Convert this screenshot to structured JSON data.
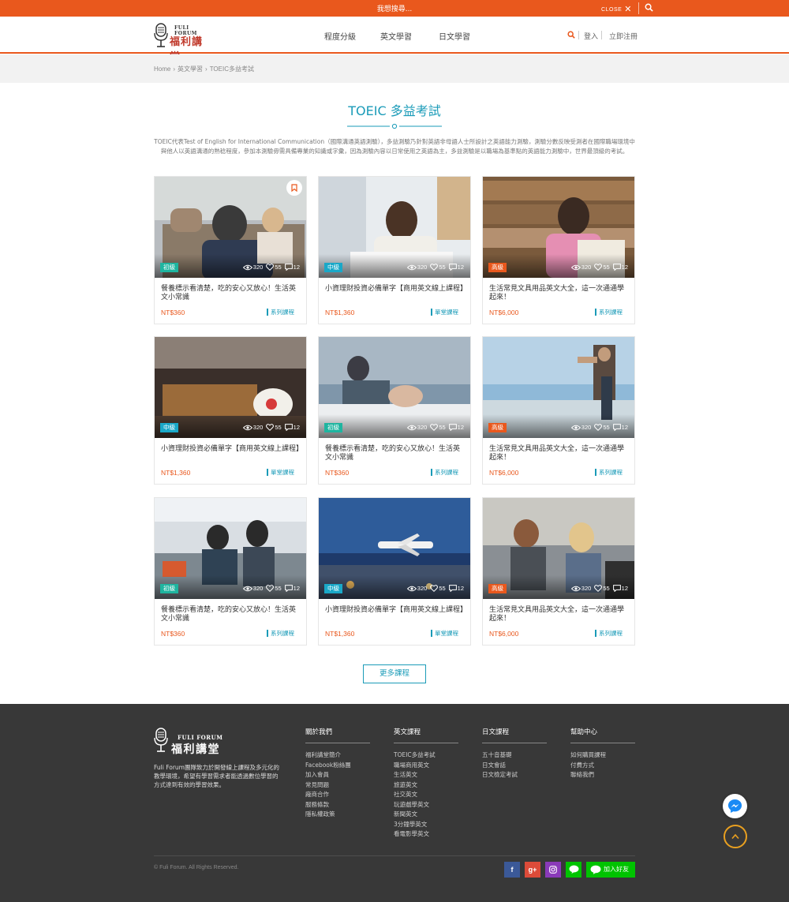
{
  "topbar": {
    "search_text": "我想搜尋...",
    "close_label": "CLOSE"
  },
  "header": {
    "logo_small": "FULI FORUM",
    "logo_big": "福利講堂",
    "nav": [
      "程度分級",
      "英文學習",
      "日文學習"
    ],
    "login": "登入",
    "register": "立即注冊"
  },
  "breadcrumb": [
    "Home",
    "英文學習",
    "TOEIC多益考試"
  ],
  "page": {
    "title": "TOEIC 多益考試",
    "intro": "TOEIC代表Test of English for International Communication（國際溝通英語測驗），多益測驗乃針對英語非母語人士所設計之英語能力測驗，測驗分數反映受測者在國際職場環境中與他人以英語溝通的熟稔程度，參加本測驗毋需具備專業的知識或字彙，因為測驗內容以日常使用之英語為主，多益測驗是以職場為基準點的英語能力測驗中，世界最頂級的考試。"
  },
  "colors": {
    "accent": "#e9581d",
    "teal": "#1a9bb8",
    "level_beginner": "#1fb5a0",
    "level_mid": "#1aa8c8",
    "level_high": "#e9581d"
  },
  "cards": [
    {
      "level": "初級",
      "level_class": "beginner",
      "views": "320",
      "likes": "55",
      "comments": "12",
      "title": "餐養標示看清楚，吃的安心又放心！生活英文小常識",
      "price": "NT$360",
      "tag": "系列課程",
      "bookmark": true
    },
    {
      "level": "中級",
      "level_class": "mid",
      "views": "320",
      "likes": "55",
      "comments": "12",
      "title": "小資理財投資必備單字【商用英文線上課程】",
      "price": "NT$1,360",
      "tag": "單堂課程",
      "bookmark": false
    },
    {
      "level": "高級",
      "level_class": "high",
      "views": "320",
      "likes": "55",
      "comments": "12",
      "title": "生活常見文具用品英文大全，這一次通通學起來！",
      "price": "NT$6,000",
      "tag": "系列課程",
      "bookmark": false
    },
    {
      "level": "中級",
      "level_class": "mid",
      "views": "320",
      "likes": "55",
      "comments": "12",
      "title": "小資理財投資必備單字【商用英文線上課程】",
      "price": "NT$1,360",
      "tag": "單堂課程",
      "bookmark": false
    },
    {
      "level": "初級",
      "level_class": "beginner",
      "views": "320",
      "likes": "55",
      "comments": "12",
      "title": "餐養標示看清楚，吃的安心又放心！生活英文小常識",
      "price": "NT$360",
      "tag": "系列課程",
      "bookmark": false
    },
    {
      "level": "高級",
      "level_class": "high",
      "views": "320",
      "likes": "55",
      "comments": "12",
      "title": "生活常見文具用品英文大全，這一次通通學起來！",
      "price": "NT$6,000",
      "tag": "系列課程",
      "bookmark": false
    },
    {
      "level": "初級",
      "level_class": "beginner",
      "views": "320",
      "likes": "55",
      "comments": "12",
      "title": "餐養標示看清楚，吃的安心又放心！生活英文小常識",
      "price": "NT$360",
      "tag": "系列課程",
      "bookmark": false
    },
    {
      "level": "中級",
      "level_class": "mid",
      "views": "320",
      "likes": "55",
      "comments": "12",
      "title": "小資理財投資必備單字【商用英文線上課程】",
      "price": "NT$1,360",
      "tag": "單堂課程",
      "bookmark": false
    },
    {
      "level": "高級",
      "level_class": "high",
      "views": "320",
      "likes": "55",
      "comments": "12",
      "title": "生活常見文具用品英文大全，這一次通通學起來！",
      "price": "NT$6,000",
      "tag": "系列課程",
      "bookmark": false
    }
  ],
  "more_button": "更多課程",
  "footer": {
    "logo_small": "FULI FORUM",
    "logo_big": "福利講堂",
    "description": "Fuli Forum團隊致力於開發線上課程及多元化的教學環境，希望有學習需求者能透過數位學習的方式達到有效的學習效果。",
    "columns": [
      {
        "title": "關於我們",
        "items": [
          "福利講堂簡介",
          "Facebook粉絲團",
          "加入會員",
          "常見問題",
          "廠商合作",
          "服務條款",
          "隱私權政策"
        ]
      },
      {
        "title": "英文課程",
        "items": [
          "TOEIC多益考試",
          "職場商用英文",
          "生活英文",
          "旅遊英文",
          "社交英文",
          "玩遊戲學英文",
          "新聞英文",
          "3分鐘學英文",
          "看電影學英文"
        ]
      },
      {
        "title": "日文課程",
        "items": [
          "五十音基礎",
          "日文會話",
          "日文檢定考試"
        ]
      },
      {
        "title": "幫助中心",
        "items": [
          "如何購買課程",
          "付費方式",
          "聯絡我們"
        ]
      }
    ],
    "copyright": "© Fuli Forum. All Rights Reserved.",
    "social": {
      "facebook": "f",
      "google": "g+",
      "add_friend": "加入好友"
    }
  }
}
